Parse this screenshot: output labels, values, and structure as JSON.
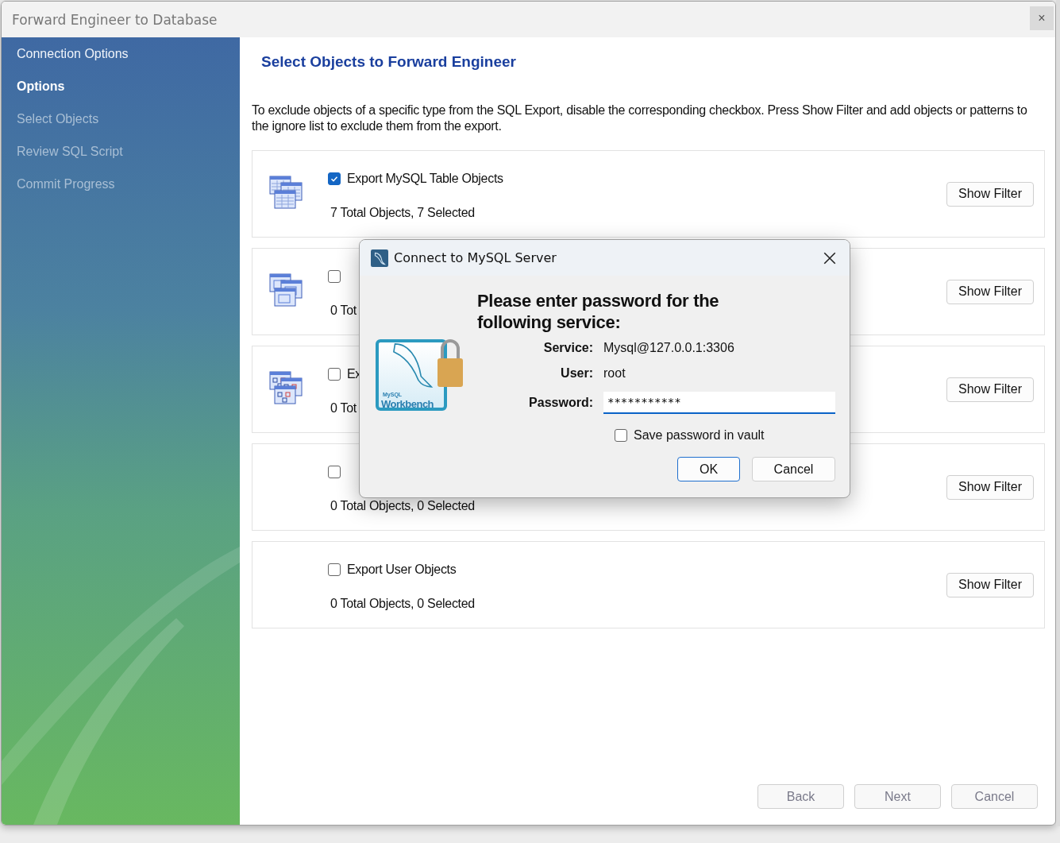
{
  "window": {
    "title": "Forward Engineer to Database",
    "close": "×"
  },
  "sidebar": {
    "items": [
      {
        "label": "Connection Options",
        "selected": false,
        "disabled": false
      },
      {
        "label": "Options",
        "selected": true,
        "disabled": false
      },
      {
        "label": "Select Objects",
        "selected": false,
        "disabled": true
      },
      {
        "label": "Review SQL Script",
        "selected": false,
        "disabled": true
      },
      {
        "label": "Commit Progress",
        "selected": false,
        "disabled": true
      }
    ]
  },
  "heading": "Select Objects to Forward Engineer",
  "description": "To exclude objects of a specific type from the SQL Export, disable the corresponding checkbox. Press Show Filter and add objects or patterns to the ignore list to exclude them from the export.",
  "sections": [
    {
      "kind": "tables",
      "checked": true,
      "label": "Export MySQL Table Objects",
      "summary": "7 Total Objects, 7 Selected",
      "button": "Show Filter"
    },
    {
      "kind": "views",
      "checked": false,
      "summary": "0 Tot",
      "button": "Show Filter"
    },
    {
      "kind": "routines",
      "checked": false,
      "label": "Ex",
      "summary": "0 Tot",
      "button": "Show Filter"
    },
    {
      "kind": "plain",
      "checked": false,
      "summary": "0 Total Objects, 0 Selected",
      "button": "Show Filter"
    },
    {
      "kind": "plain",
      "checked": false,
      "label": "Export User Objects",
      "summary": "0 Total Objects, 0 Selected",
      "button": "Show Filter"
    }
  ],
  "footer_buttons": [
    {
      "label": "Back",
      "disabled": true
    },
    {
      "label": "Next",
      "disabled": true
    },
    {
      "label": "Cancel",
      "disabled": true
    }
  ],
  "dialog": {
    "title": "Connect to MySQL Server",
    "logo_brand": "MySQL",
    "logo_text": "Workbench",
    "prompt": "Please enter password for the following service:",
    "fields": [
      {
        "label": "Service:",
        "value": "Mysql@127.0.0.1:3306",
        "kind": "text"
      },
      {
        "label": "User:",
        "value": "root",
        "kind": "text"
      },
      {
        "label": "Password:",
        "value": "***********",
        "kind": "input"
      }
    ],
    "save_password": {
      "label": "Save password in vault",
      "checked": false
    },
    "buttons": [
      {
        "label": "OK",
        "default": true
      },
      {
        "label": "Cancel",
        "default": false
      }
    ]
  }
}
